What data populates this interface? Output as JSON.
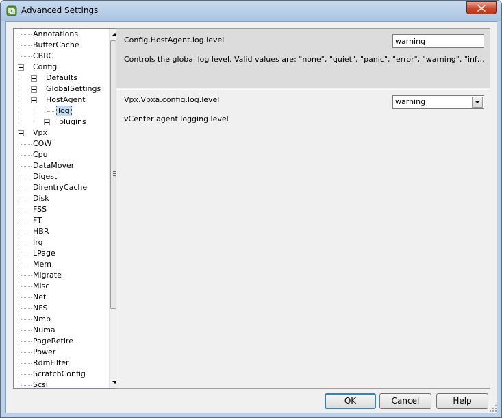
{
  "window": {
    "title": "Advanced Settings"
  },
  "tree": {
    "items": [
      {
        "label": "Annotations"
      },
      {
        "label": "BufferCache"
      },
      {
        "label": "CBRC"
      },
      {
        "label": "Config"
      },
      {
        "label": "Defaults"
      },
      {
        "label": "GlobalSettings"
      },
      {
        "label": "HostAgent"
      },
      {
        "label": "log"
      },
      {
        "label": "plugins"
      },
      {
        "label": "Vpx"
      },
      {
        "label": "COW"
      },
      {
        "label": "Cpu"
      },
      {
        "label": "DataMover"
      },
      {
        "label": "Digest"
      },
      {
        "label": "DirentryCache"
      },
      {
        "label": "Disk"
      },
      {
        "label": "FSS"
      },
      {
        "label": "FT"
      },
      {
        "label": "HBR"
      },
      {
        "label": "Irq"
      },
      {
        "label": "LPage"
      },
      {
        "label": "Mem"
      },
      {
        "label": "Migrate"
      },
      {
        "label": "Misc"
      },
      {
        "label": "Net"
      },
      {
        "label": "NFS"
      },
      {
        "label": "Nmp"
      },
      {
        "label": "Numa"
      },
      {
        "label": "PageRetire"
      },
      {
        "label": "Power"
      },
      {
        "label": "RdmFilter"
      },
      {
        "label": "ScratchConfig"
      },
      {
        "label": "Scsi"
      }
    ]
  },
  "settings": [
    {
      "name": "Config.HostAgent.log.level",
      "value": "warning",
      "description": "Controls the global log level. Valid values are: \"none\", \"quiet\", \"panic\", \"error\", \"warning\", \"info\", \"verbose\", \"trivia\"."
    },
    {
      "name": "Vpx.Vpxa.config.log.level",
      "value": "warning",
      "description": "vCenter agent logging level"
    }
  ],
  "buttons": {
    "ok": "OK",
    "cancel": "Cancel",
    "help": "Help"
  }
}
